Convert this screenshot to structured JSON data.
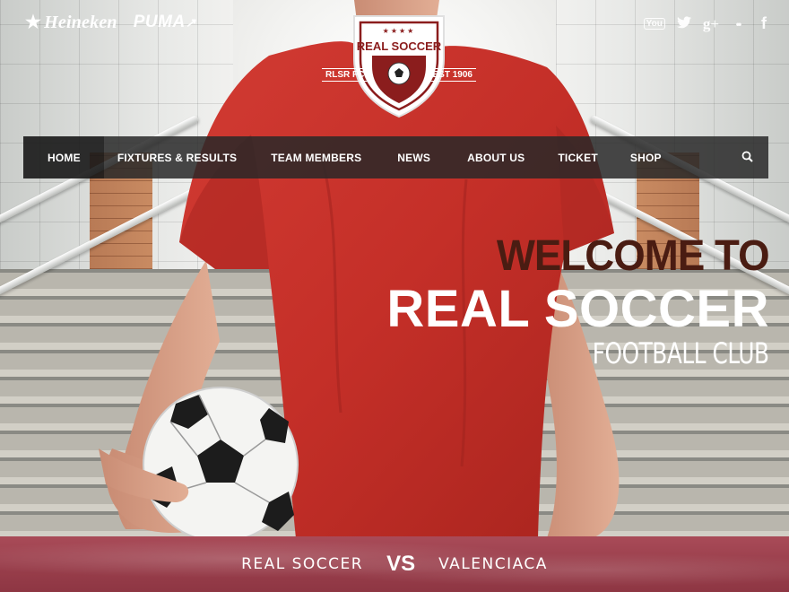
{
  "sponsors": {
    "heineken": "Heineken",
    "puma": "PUMA"
  },
  "social": {
    "youtube": "You",
    "twitter": "t",
    "googleplus": "g+",
    "flickr": "••",
    "facebook": "f"
  },
  "crest": {
    "name": "REAL SOCCER",
    "left_text": "RLSR FC.",
    "right_text": "EST 1906",
    "stars": "★★★★"
  },
  "nav": {
    "items": [
      {
        "label": "HOME"
      },
      {
        "label": "FIXTURES & RESULTS"
      },
      {
        "label": "TEAM MEMBERS"
      },
      {
        "label": "NEWS"
      },
      {
        "label": "ABOUT US"
      },
      {
        "label": "TICKET"
      },
      {
        "label": "SHOP"
      }
    ]
  },
  "hero": {
    "welcome": "WELCOME TO",
    "name": "REAL SOCCER",
    "subtitle": "FOOTBALL CLUB"
  },
  "match": {
    "home_team": "REAL SOCCER",
    "vs": "VS",
    "away_team": "VALENCIACA"
  },
  "colors": {
    "nav_bg": "#282828",
    "jersey_red": "#c62f2a",
    "crest_red": "#8b1d1d",
    "welcome_text": "#4a1c12",
    "match_bar": "#9a3f4c"
  }
}
